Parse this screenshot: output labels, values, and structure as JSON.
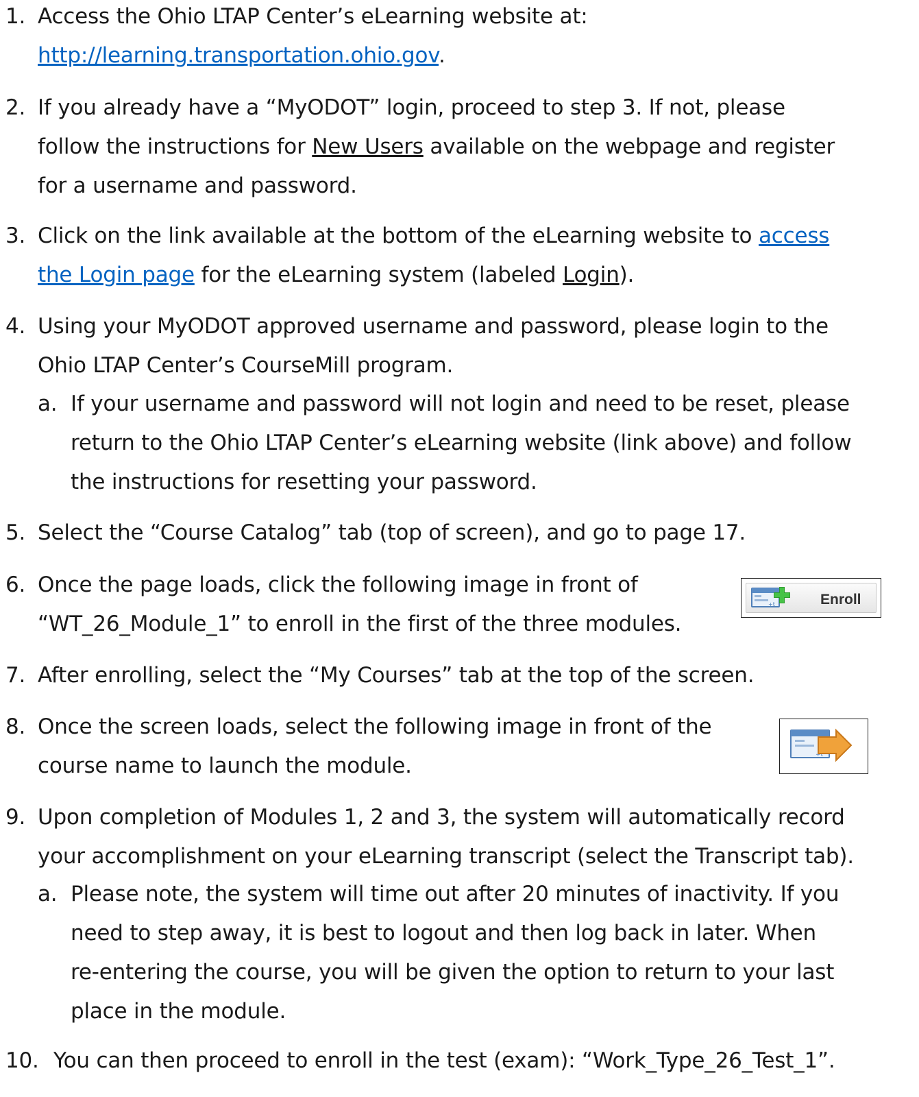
{
  "steps": [
    {
      "num": "1.",
      "lines": [
        "Access the Ohio LTAP Center’s eLearning website at:"
      ],
      "link": "http://learning.transportation.ohio.gov",
      "link_suffix": "."
    },
    {
      "num": "2.",
      "line1": "If you already have a “MyODOT” login, proceed to step 3.  If not, please",
      "line2_pre": "follow the instructions for ",
      "line2_u": "New Users",
      "line2_post": " available on the webpage and register",
      "line3": "for a username and password."
    },
    {
      "num": "3.",
      "line1_pre": "Click on the link available at the bottom of the eLearning website to ",
      "line1_link": "access",
      "line2_link": "the Login page",
      "line2_mid": " for the eLearning system (labeled ",
      "line2_u": "Login",
      "line2_post": ")."
    },
    {
      "num": "4.",
      "line1": "Using your MyODOT approved username and password, please login to the",
      "line2": "Ohio LTAP Center’s CourseMill program.",
      "sub_letter": "a.",
      "sub1": "If your username and password will not login and need to be reset, please",
      "sub2": "return to the Ohio LTAP Center’s eLearning website (link above) and follow",
      "sub3": "the instructions for resetting your password."
    },
    {
      "num": "5.",
      "line1": "Select the “Course Catalog” tab (top of screen), and go to page 17."
    },
    {
      "num": "6.",
      "line1": "Once the page loads, click the following image in front of",
      "line2": "“WT_26_Module_1” to enroll in the first of the three modules.",
      "image_label": "Enroll"
    },
    {
      "num": "7.",
      "line1": "After enrolling, select the “My Courses” tab at the top of the screen."
    },
    {
      "num": "8.",
      "line1": "Once the screen loads, select the following image in front of the",
      "line2": "course name to launch the module."
    },
    {
      "num": "9.",
      "line1": "Upon completion of Modules 1, 2 and 3, the system will automatically record",
      "line2": "your accomplishment on your eLearning transcript (select the Transcript tab).",
      "sub_letter": "a.",
      "sub1": "Please note, the system will time out after 20 minutes of inactivity.  If you",
      "sub2": "need to step away, it is best to logout and then log back in later.  When",
      "sub3": "re-entering the course, you will be given the option to return to your last",
      "sub4": "place in the module."
    },
    {
      "num": "10.",
      "line1": "You can then proceed to enroll in the test (exam): “Work_Type_26_Test_1”."
    }
  ],
  "icons": {
    "enroll": "enroll-plus-icon",
    "launch": "launch-arrow-icon"
  },
  "colors": {
    "link": "#0563c1",
    "text": "#1a1a1a"
  }
}
